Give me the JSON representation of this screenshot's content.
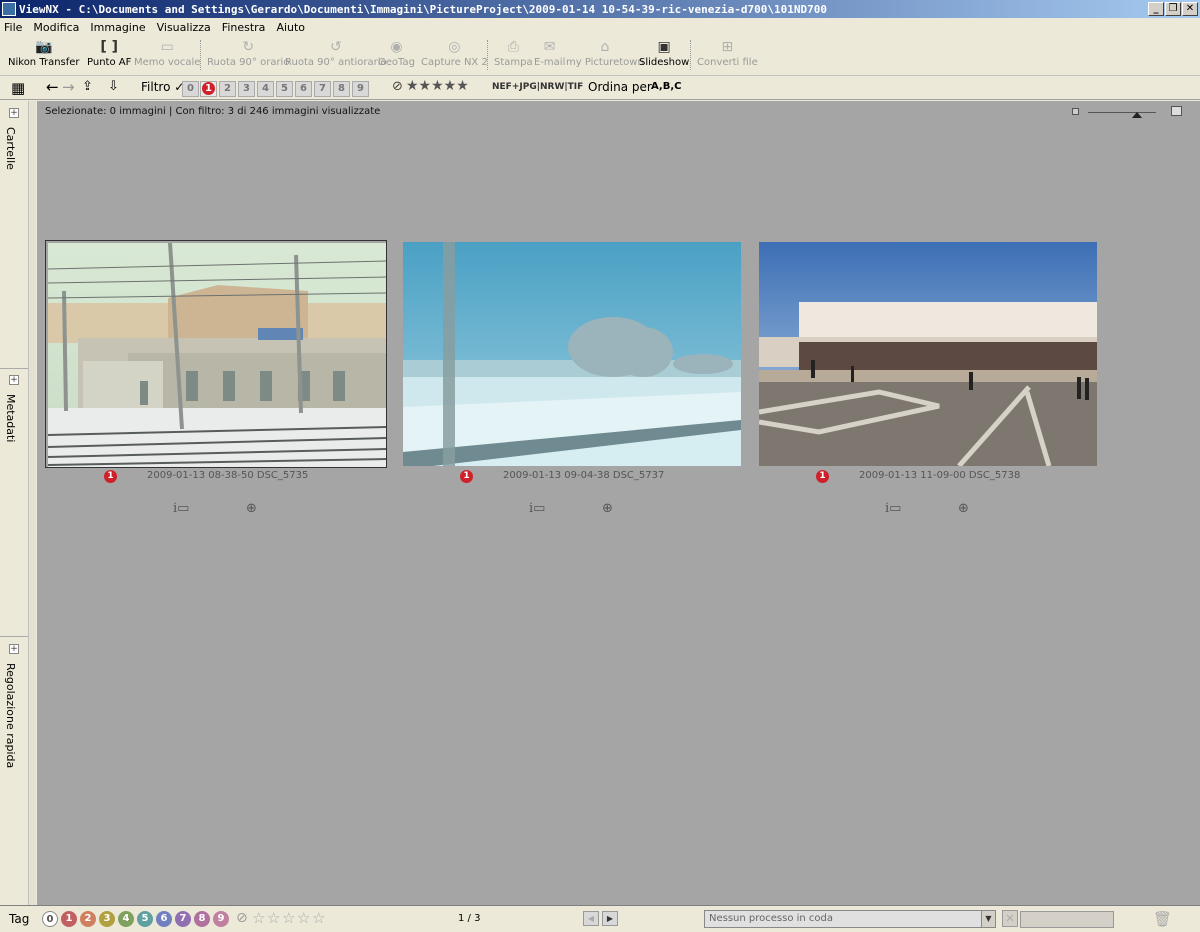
{
  "window": {
    "title": "ViewNX - C:\\Documents and Settings\\Gerardo\\Documenti\\Immagini\\PictureProject\\2009-01-14 10-54-39-ric-venezia-d700\\101ND700",
    "minimize": "_",
    "restore": "❐",
    "close": "✕"
  },
  "menu": [
    "File",
    "Modifica",
    "Immagine",
    "Visualizza",
    "Finestra",
    "Aiuto"
  ],
  "toolbar": {
    "nikon_transfer": "Nikon Transfer",
    "punto_af": "Punto AF",
    "memo_vocale": "Memo vocale",
    "ruota_orario": "Ruota 90° orario",
    "ruota_antiorario": "Ruota 90° antiorario",
    "geotag": "GeoTag",
    "capture_nx2": "Capture NX 2",
    "stampa": "Stampa",
    "email": "E-mail",
    "my_picturetown": "my Picturetown",
    "slideshow": "Slideshow",
    "converti_file": "Converti file"
  },
  "filterbar": {
    "filtro": "Filtro ✓",
    "numbers": [
      "0",
      "1",
      "2",
      "3",
      "4",
      "5",
      "6",
      "7",
      "8",
      "9"
    ],
    "active_number": "1",
    "stars": "★★★★★",
    "formats": "NEF+JPG|NRW|TIF",
    "sort": "Ordina per",
    "sort_icon": "A,B,C"
  },
  "left_panel": {
    "cartelle": "Cartelle",
    "metadati": "Metadati",
    "regolazione": "Regolazione rapida"
  },
  "content": {
    "status": "Selezionate: 0 immagini | Con filtro: 3 di 246 immagini visualizzate",
    "thumbnails": [
      {
        "badge": "1",
        "caption": "2009-01-13 08-38-50 DSC_5735"
      },
      {
        "badge": "1",
        "caption": "2009-01-13 09-04-38 DSC_5737"
      },
      {
        "badge": "1",
        "caption": "2009-01-13 11-09-00 DSC_5738"
      }
    ]
  },
  "bottombar": {
    "tag": "Tag",
    "tag_numbers": [
      "0",
      "1",
      "2",
      "3",
      "4",
      "5",
      "6",
      "7",
      "8",
      "9"
    ],
    "tag_colors": [
      "#ffffff",
      "#c06060",
      "#d08060",
      "#b0a040",
      "#80a060",
      "#60a0a0",
      "#7080c0",
      "#9070b0",
      "#b070a0",
      "#c080a0"
    ],
    "page": "1 / 3",
    "queue": "Nessun processo in coda"
  }
}
